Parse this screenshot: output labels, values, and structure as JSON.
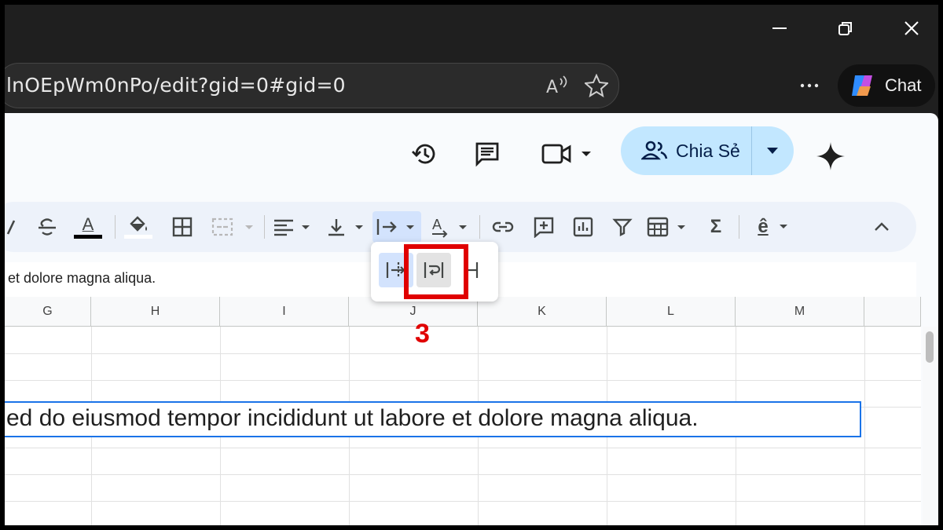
{
  "browser": {
    "url": "lnOEpWm0nPo/edit?gid=0#gid=0",
    "icons": [
      "minimize-icon",
      "restore-icon",
      "close-icon",
      "read-aloud-icon",
      "favorite-star-icon",
      "more-icon",
      "copilot-icon"
    ],
    "chat_label": "Chat"
  },
  "header": {
    "share_label": "Chia Sẻ",
    "icons": [
      "history-icon",
      "comment-icon",
      "meet-video-icon",
      "people-icon",
      "gemini-sparkle-icon"
    ],
    "share_color": "#c2e7ff"
  },
  "toolbar": {
    "icons": [
      "italic-icon",
      "strikethrough-icon",
      "text-color-icon",
      "fill-color-icon",
      "borders-icon",
      "merge-cells-icon",
      "horizontal-align-icon",
      "vertical-align-icon",
      "text-wrapping-icon",
      "text-rotation-icon",
      "insert-link-icon",
      "insert-comment-icon",
      "insert-chart-icon",
      "filter-icon",
      "filter-views-icon",
      "functions-icon",
      "input-tools-icon",
      "collapse-toolbar-icon"
    ],
    "text_color_glyph": "A",
    "rotation_glyph": "A",
    "input_tools_glyph": "ê",
    "functions_glyph": "Σ"
  },
  "formula_bar": {
    "text": "et dolore magna aliqua."
  },
  "sheet": {
    "columns": [
      "G",
      "H",
      "I",
      "J",
      "K",
      "L",
      "M"
    ],
    "selected_cell_text": "ed do eiusmod tempor incididunt ut labore et dolore magna aliqua.",
    "selection_color": "#1a73e8"
  },
  "wrap_menu": {
    "options": [
      "overflow",
      "wrap",
      "clip"
    ],
    "selected": "overflow",
    "hovered": "wrap"
  },
  "annotation": {
    "step_number": "3",
    "color": "#e00000"
  }
}
